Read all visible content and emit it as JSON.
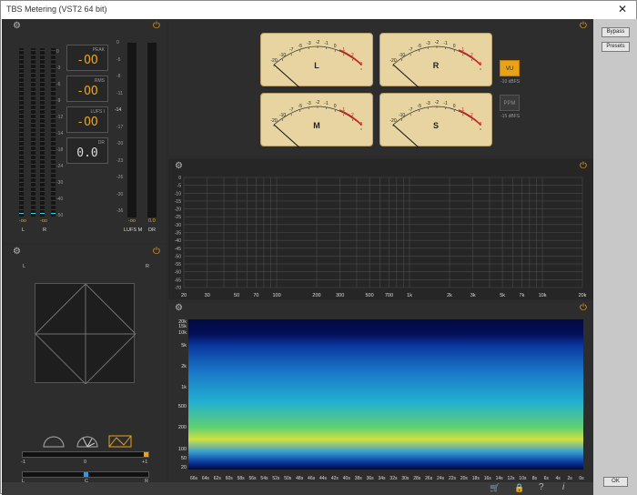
{
  "window": {
    "title": "TBS Metering (VST2 64 bit)",
    "close": "✕"
  },
  "sidebar": {
    "bypass": "Bypass",
    "presets": "Presets",
    "ok": "OK"
  },
  "level_panel": {
    "scale": [
      "0",
      "-3",
      "-6",
      "-9",
      "-12",
      "-14",
      "-18",
      "-24",
      "-30",
      "-40",
      "-50"
    ],
    "lufs_scale": [
      "0",
      "-5",
      "-8",
      "-11",
      "-14",
      "-17",
      "-20",
      "-23",
      "-26",
      "-30",
      "-36"
    ],
    "peak": {
      "caption": "PEAK",
      "value": "-OO"
    },
    "rms": {
      "caption": "RMS",
      "value": "-OO"
    },
    "lufs": {
      "caption": "LUFS I",
      "value": "-OO"
    },
    "dr": {
      "caption": "DR",
      "value": "0.0"
    },
    "readouts": [
      "-oo",
      "-oo",
      "-oo",
      "0.0"
    ],
    "channel_labels": [
      "L",
      "R",
      "LUFS M",
      "DR"
    ],
    "meter_levels": [
      0,
      0,
      0,
      0
    ]
  },
  "vu_panel": {
    "meters": [
      "L",
      "R",
      "M",
      "S"
    ],
    "scale_labels": [
      "-20",
      "-10",
      "-7",
      "-5",
      "-3",
      "-2",
      "-1",
      "0",
      "1",
      "2",
      "3"
    ],
    "vu_button": "VU",
    "vu_ref": "-10 dBFS",
    "ppm_button": "PPM",
    "ppm_ref": "-15 dBFS"
  },
  "spectrum": {
    "y_labels": [
      "0",
      "-5",
      "-10",
      "-15",
      "-20",
      "-25",
      "-30",
      "-35",
      "-40",
      "-45",
      "-50",
      "-55",
      "-60",
      "-65",
      "-70"
    ],
    "x_labels": [
      "20",
      "30",
      "50",
      "70",
      "100",
      "200",
      "300",
      "500",
      "700",
      "1k",
      "2k",
      "3k",
      "5k",
      "7k",
      "10k",
      "20k"
    ]
  },
  "spectrogram": {
    "freq_labels": [
      "20k",
      "15k",
      "10k",
      "5k",
      "2k",
      "1k",
      "500",
      "200",
      "100",
      "50",
      "20"
    ],
    "time_labels": [
      "66s",
      "64s",
      "62s",
      "60s",
      "58s",
      "56s",
      "54s",
      "52s",
      "50s",
      "48s",
      "46s",
      "44s",
      "42s",
      "40s",
      "38s",
      "36s",
      "34s",
      "32s",
      "30s",
      "28s",
      "26s",
      "24s",
      "22s",
      "20s",
      "18s",
      "16s",
      "14s",
      "12s",
      "10s",
      "8s",
      "6s",
      "4s",
      "2s",
      "0s"
    ]
  },
  "stereo_panel": {
    "left": "L",
    "right": "R",
    "corr_labels": [
      "-1",
      "0",
      "+1"
    ],
    "bal_labels": [
      "L",
      "C",
      "R"
    ],
    "correlation": 1.0,
    "balance": 0.5
  },
  "footer_icons": [
    "cart-icon",
    "lock-icon",
    "help-icon",
    "info-icon"
  ],
  "colors": {
    "accent": "#e8a21a",
    "panel": "#2d2d2d",
    "vu_face": "#e8d4a0"
  }
}
